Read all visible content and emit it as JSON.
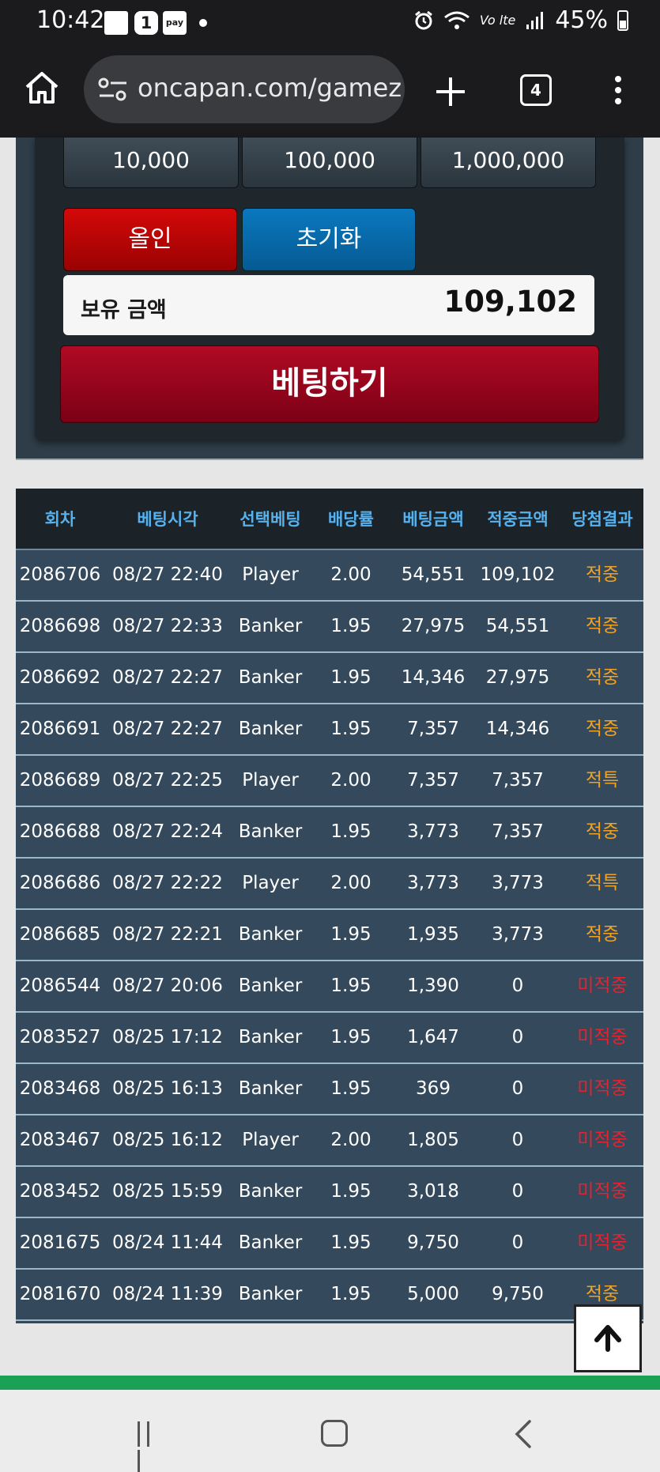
{
  "status_bar": {
    "time": "10:42",
    "badge": "1",
    "pay": "pay",
    "network": "Vo lte",
    "battery": "45%"
  },
  "browser": {
    "url": "oncapan.com/gamez",
    "tab_count": "4"
  },
  "bet_panel": {
    "chips": [
      "10,000",
      "100,000",
      "1,000,000"
    ],
    "allin_label": "올인",
    "reset_label": "초기화",
    "balance_label": "보유 금액",
    "balance_value": "109,102",
    "bet_label": "베팅하기"
  },
  "history": {
    "headers": [
      "회차",
      "베팅시각",
      "선택베팅",
      "배당률",
      "베팅금액",
      "적중금액",
      "당첨결과"
    ],
    "rows": [
      [
        "2086706",
        "08/27 22:40",
        "Player",
        "2.00",
        "54,551",
        "109,102",
        "적중"
      ],
      [
        "2086698",
        "08/27 22:33",
        "Banker",
        "1.95",
        "27,975",
        "54,551",
        "적중"
      ],
      [
        "2086692",
        "08/27 22:27",
        "Banker",
        "1.95",
        "14,346",
        "27,975",
        "적중"
      ],
      [
        "2086691",
        "08/27 22:27",
        "Banker",
        "1.95",
        "7,357",
        "14,346",
        "적중"
      ],
      [
        "2086689",
        "08/27 22:25",
        "Player",
        "2.00",
        "7,357",
        "7,357",
        "적특"
      ],
      [
        "2086688",
        "08/27 22:24",
        "Banker",
        "1.95",
        "3,773",
        "7,357",
        "적중"
      ],
      [
        "2086686",
        "08/27 22:22",
        "Player",
        "2.00",
        "3,773",
        "3,773",
        "적특"
      ],
      [
        "2086685",
        "08/27 22:21",
        "Banker",
        "1.95",
        "1,935",
        "3,773",
        "적중"
      ],
      [
        "2086544",
        "08/27 20:06",
        "Banker",
        "1.95",
        "1,390",
        "0",
        "미적중"
      ],
      [
        "2083527",
        "08/25 17:12",
        "Banker",
        "1.95",
        "1,647",
        "0",
        "미적중"
      ],
      [
        "2083468",
        "08/25 16:13",
        "Banker",
        "1.95",
        "369",
        "0",
        "미적중"
      ],
      [
        "2083467",
        "08/25 16:12",
        "Player",
        "2.00",
        "1,805",
        "0",
        "미적중"
      ],
      [
        "2083452",
        "08/25 15:59",
        "Banker",
        "1.95",
        "3,018",
        "0",
        "미적중"
      ],
      [
        "2081675",
        "08/24 11:44",
        "Banker",
        "1.95",
        "9,750",
        "0",
        "미적중"
      ],
      [
        "2081670",
        "08/24 11:39",
        "Banker",
        "1.95",
        "5,000",
        "9,750",
        "적중"
      ]
    ]
  },
  "colors": {
    "hit": "#f2a21e",
    "miss": "#e5222e",
    "header_text": "#56b2ee",
    "row_bg": "#34495c"
  }
}
